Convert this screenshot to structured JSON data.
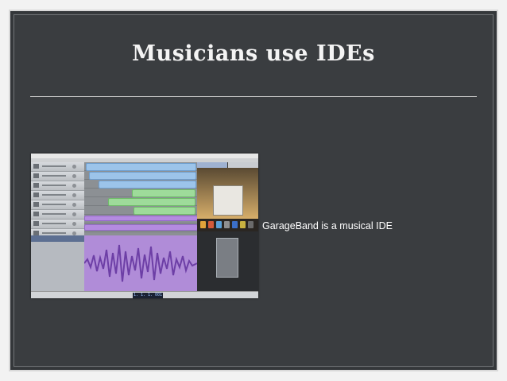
{
  "slide": {
    "title": "Musicians use IDEs",
    "caption": "GarageBand is a musical IDE"
  },
  "screenshot": {
    "app_name": "GarageBand",
    "lcd_readout": "1. 1. 1. 001"
  },
  "colors": {
    "slide_background": "#3a3d40",
    "title_text": "#f4f4f4",
    "region_blue": "#9cc4ea",
    "region_green": "#9edb9a",
    "region_purple": "#b48be0"
  }
}
